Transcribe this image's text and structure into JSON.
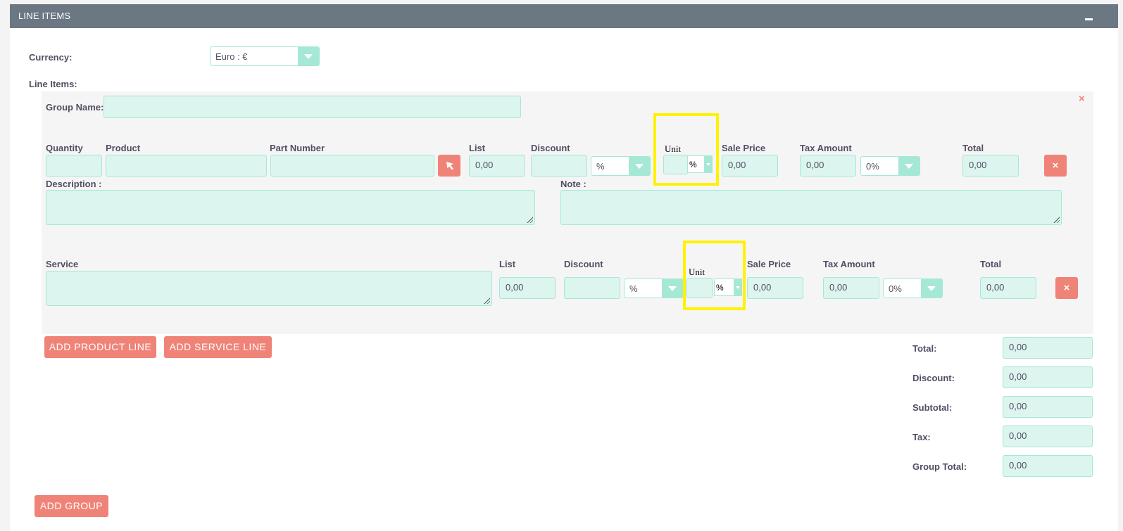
{
  "header": {
    "title": "LINE ITEMS"
  },
  "currency": {
    "label": "Currency:",
    "value": "Euro : €"
  },
  "line_items_label": "Line Items:",
  "group": {
    "name_label": "Group Name:",
    "name_value": ""
  },
  "product_line": {
    "labels": {
      "quantity": "Quantity",
      "product": "Product",
      "part_number": "Part Number",
      "list": "List",
      "discount": "Discount",
      "unit": "Unit",
      "sale_price": "Sale Price",
      "tax_amount": "Tax Amount",
      "total": "Total",
      "description": "Description :",
      "note": "Note :"
    },
    "values": {
      "list": "0,00",
      "discount_type": "%",
      "unit_type": "%",
      "sale_price": "0,00",
      "tax_amount": "0,00",
      "tax_rate": "0%",
      "total": "0,00"
    }
  },
  "service_line": {
    "labels": {
      "service": "Service",
      "list": "List",
      "discount": "Discount",
      "unit": "Unit",
      "sale_price": "Sale Price",
      "tax_amount": "Tax Amount",
      "total": "Total"
    },
    "values": {
      "list": "0,00",
      "discount_type": "%",
      "unit_type": "%",
      "sale_price": "0,00",
      "tax_amount": "0,00",
      "tax_rate": "0%",
      "total": "0,00"
    }
  },
  "buttons": {
    "add_product_line": "ADD PRODUCT LINE",
    "add_service_line": "ADD SERVICE LINE",
    "add_group": "ADD GROUP"
  },
  "totals": [
    {
      "label": "Total:",
      "value": "0,00"
    },
    {
      "label": "Discount:",
      "value": "0,00"
    },
    {
      "label": "Subtotal:",
      "value": "0,00"
    },
    {
      "label": "Tax:",
      "value": "0,00"
    },
    {
      "label": "Group Total:",
      "value": "0,00"
    }
  ],
  "colors": {
    "header": "#6b7783",
    "field": "#dcf5ee",
    "accent": "#a5e8d6",
    "button": "#f08377",
    "highlight": "#fff200"
  }
}
